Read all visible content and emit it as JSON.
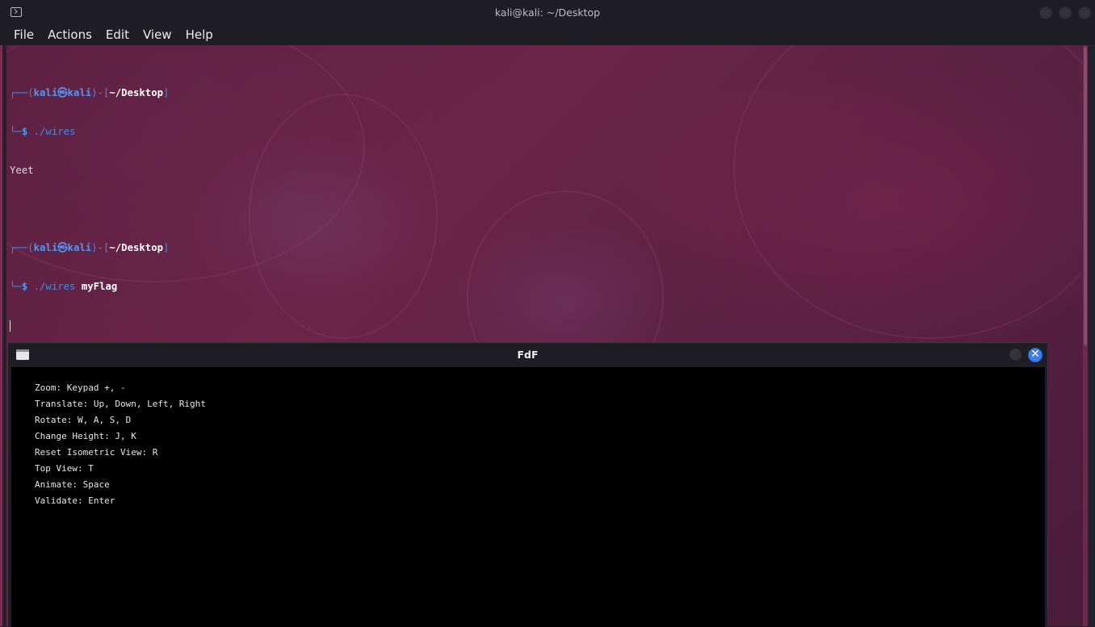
{
  "terminal": {
    "title": "kali@kali: ~/Desktop",
    "menu": [
      "File",
      "Actions",
      "Edit",
      "View",
      "Help"
    ],
    "lines": [
      {
        "kind": "prompt-top",
        "open": "┌──(",
        "user": "kali㉿kali",
        "mid": ")-[",
        "path": "~/Desktop",
        "close": "]"
      },
      {
        "kind": "prompt-cmd",
        "prefix": "└─",
        "dollar": "$",
        "cmd": "./wires",
        "arg": ""
      },
      {
        "kind": "output",
        "text": "Yeet"
      },
      {
        "kind": "blank",
        "text": ""
      },
      {
        "kind": "prompt-top",
        "open": "┌──(",
        "user": "kali㉿kali",
        "mid": ")-[",
        "path": "~/Desktop",
        "close": "]"
      },
      {
        "kind": "prompt-cmd",
        "prefix": "└─",
        "dollar": "$",
        "cmd": "./wires",
        "arg": "myFlag"
      }
    ]
  },
  "fdf": {
    "title": "FdF",
    "close_glyph": "✕",
    "help": [
      "Zoom: Keypad +, -",
      "Translate: Up, Down, Left, Right",
      "Rotate: W, A, S, D",
      "Change Height: J, K",
      "Reset Isometric View: R",
      "Top View: T",
      "Animate: Space",
      "Validate: Enter"
    ]
  },
  "colors": {
    "prompt_frame": "#3b8eea",
    "prompt_user": "#5597f0",
    "prompt_dollar": "#5597f0",
    "command": "#3b8eea",
    "argument": "#ffffff",
    "fdf_close": "#3d7fe8"
  }
}
